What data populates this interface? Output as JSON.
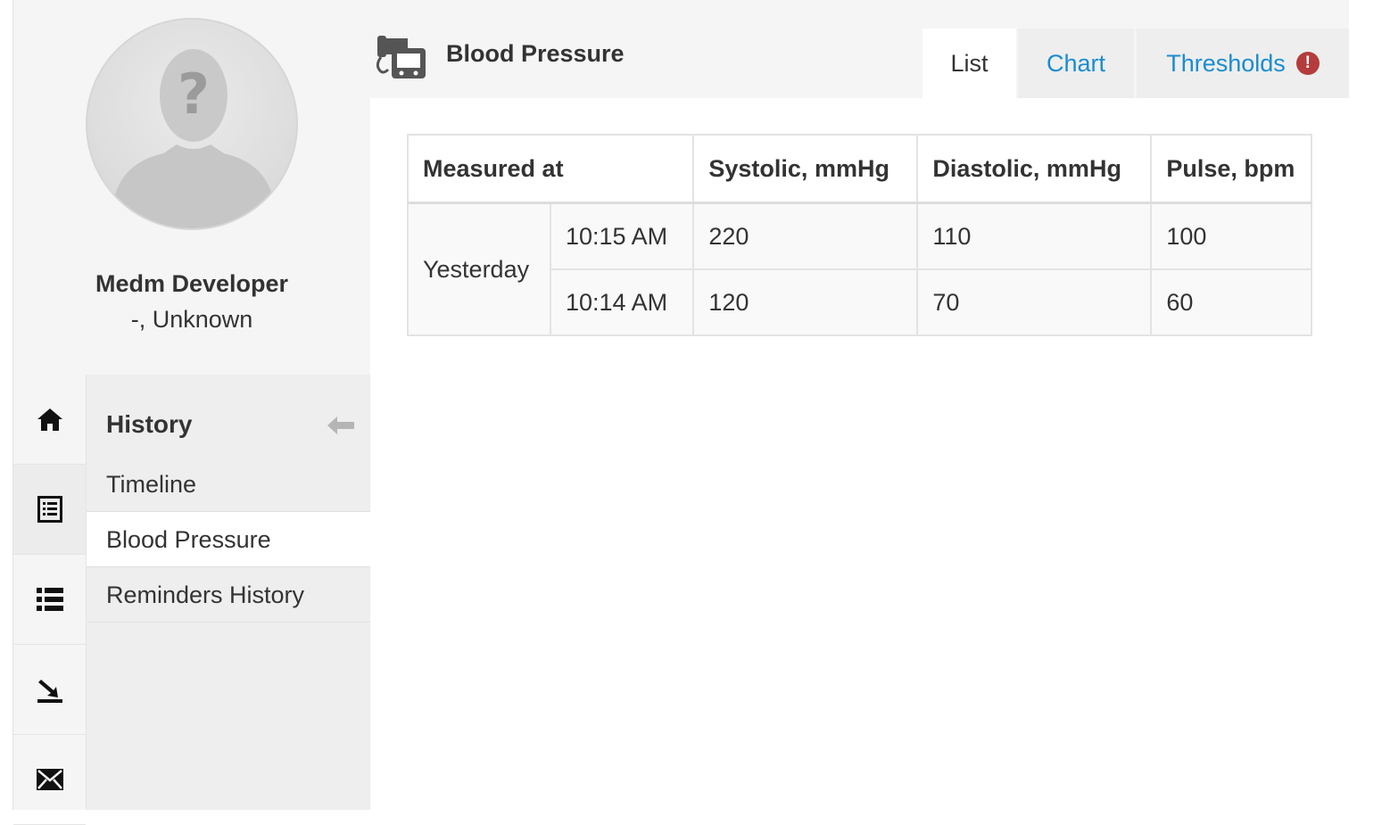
{
  "profile": {
    "name": "Medm Developer",
    "subtitle": "-, Unknown"
  },
  "rail": {
    "items": [
      {
        "icon": "home-icon"
      },
      {
        "icon": "history-icon"
      },
      {
        "icon": "list-icon"
      },
      {
        "icon": "export-icon"
      },
      {
        "icon": "mail-icon"
      }
    ]
  },
  "submenu": {
    "heading": "History",
    "items": [
      {
        "label": "Timeline"
      },
      {
        "label": "Blood Pressure"
      },
      {
        "label": "Reminders History"
      }
    ]
  },
  "header": {
    "title": "Blood Pressure",
    "tabs": [
      {
        "label": "List"
      },
      {
        "label": "Chart"
      },
      {
        "label": "Thresholds"
      }
    ],
    "alert_symbol": "!"
  },
  "table": {
    "headers": [
      "Measured at",
      "Systolic, mmHg",
      "Diastolic, mmHg",
      "Pulse, bpm"
    ],
    "day": "Yesterday",
    "rows": [
      {
        "time": "10:15 AM",
        "systolic": "220",
        "diastolic": "110",
        "pulse": "100"
      },
      {
        "time": "10:14 AM",
        "systolic": "120",
        "diastolic": "70",
        "pulse": "60"
      }
    ]
  },
  "colors": {
    "link": "#1a8cd0",
    "alert": "#b43c3c"
  }
}
